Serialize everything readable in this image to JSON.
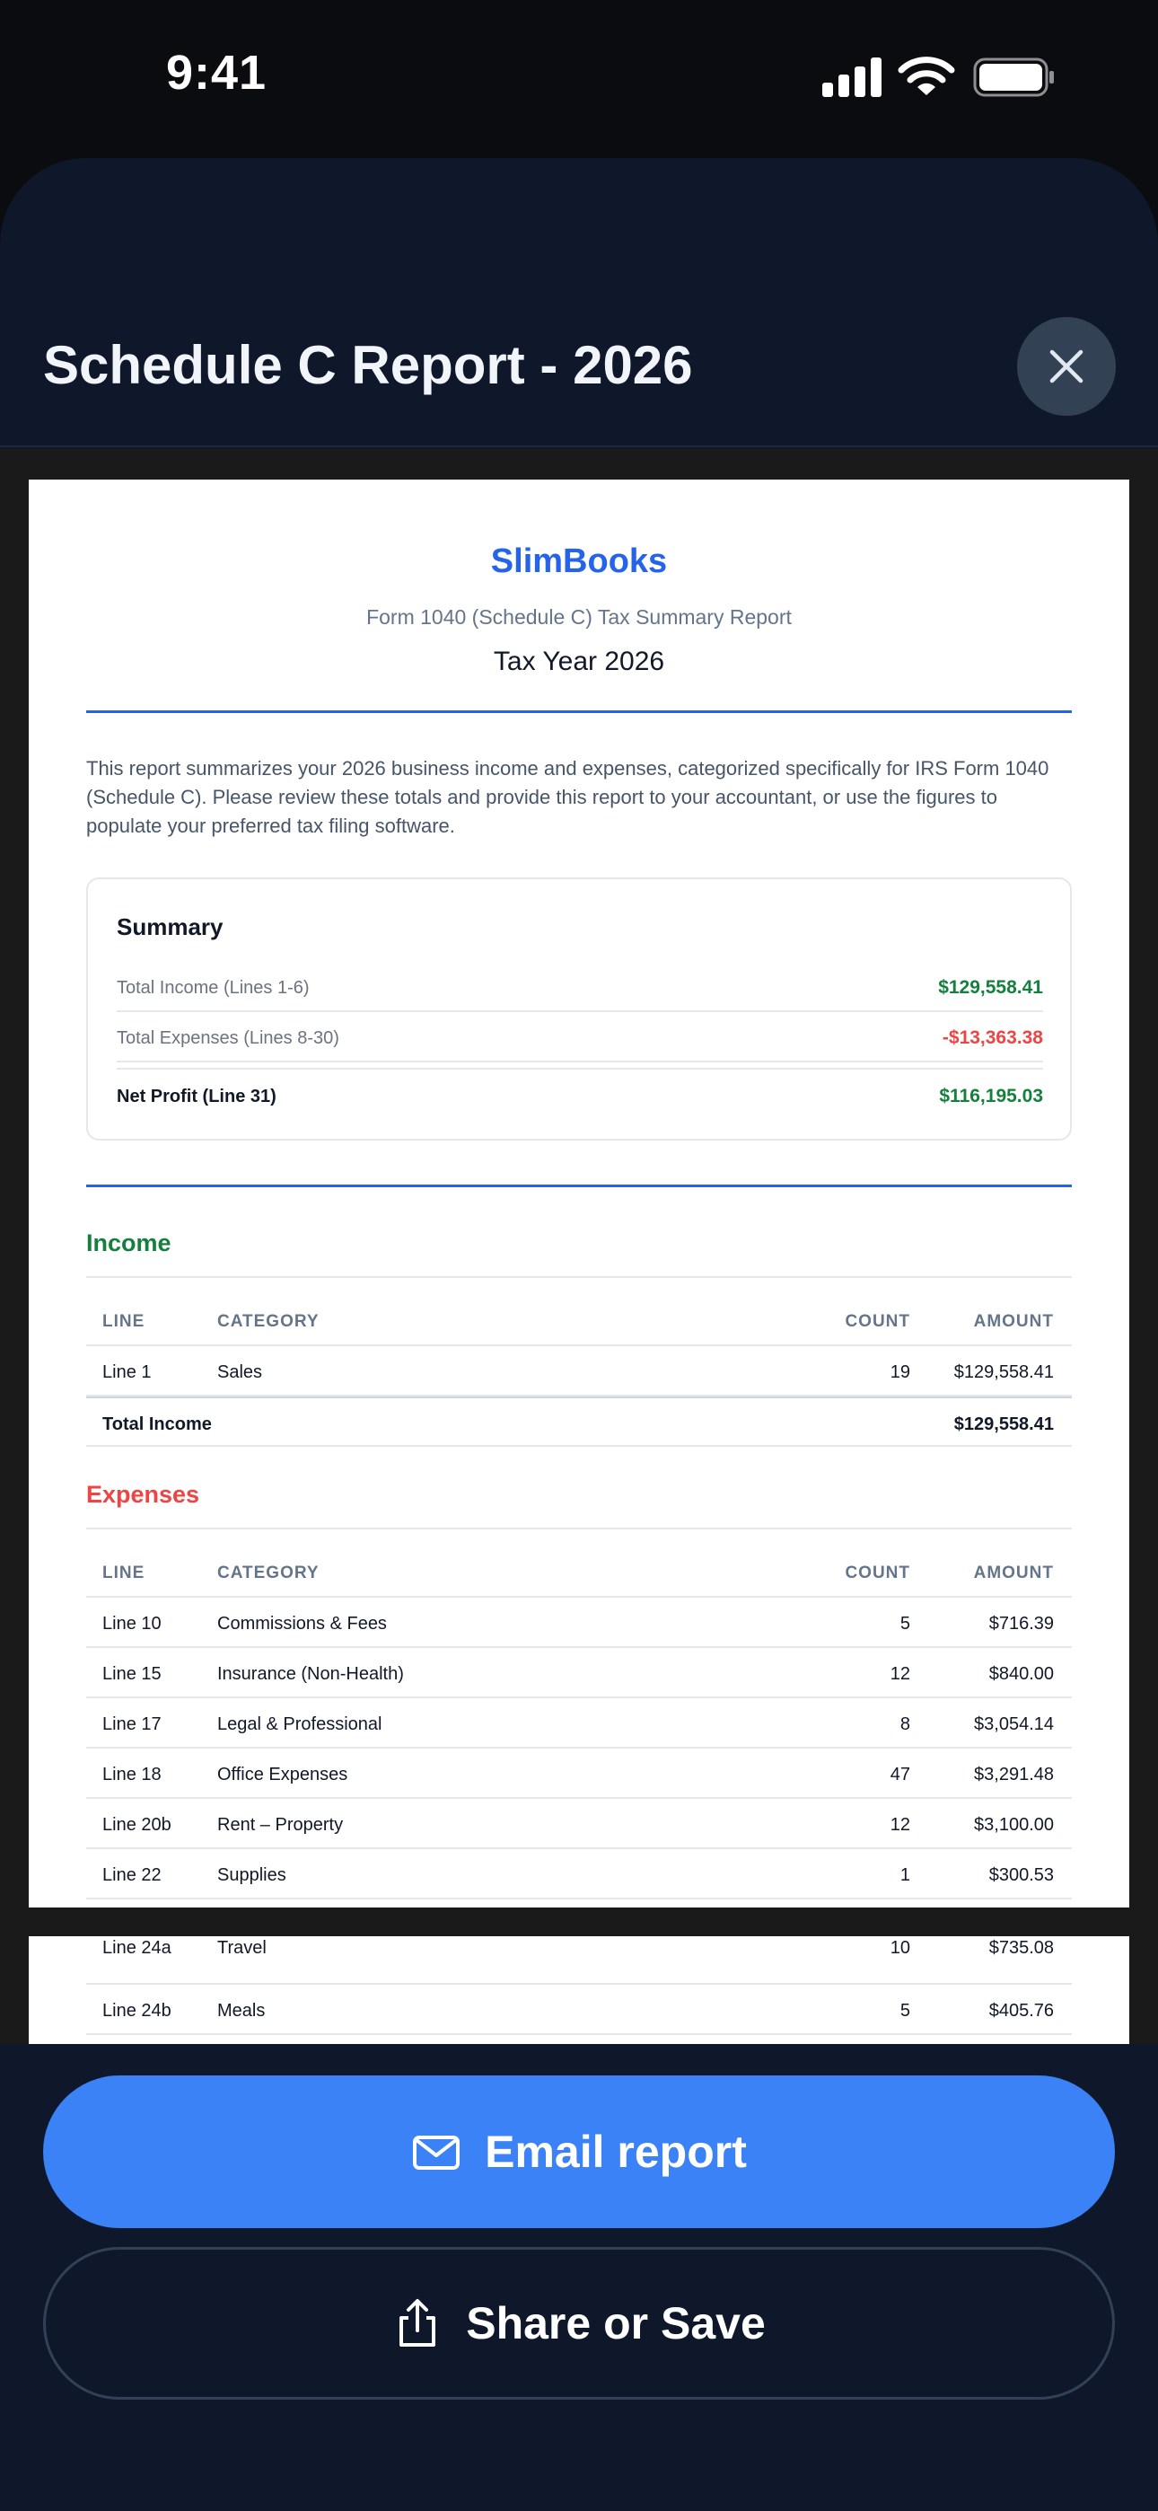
{
  "status_bar": {
    "time": "9:41",
    "icons": [
      "signal-icon",
      "wifi-icon",
      "battery-icon"
    ]
  },
  "sheet": {
    "title": "Schedule C Report - 2026",
    "close_icon": "close-icon"
  },
  "report": {
    "brand": "SlimBooks",
    "subtitle": "Form 1040 (Schedule C) Tax Summary Report",
    "year": "Tax Year 2026",
    "intro": "This report summarizes your 2026 business income and expenses, categorized specifically for IRS Form 1040 (Schedule C). Please review these totals and provide this report to your accountant, or use the figures to populate your preferred tax filing software.",
    "summary": {
      "title": "Summary",
      "income_label": "Total Income (Lines 1-6)",
      "income_value": "$129,558.41",
      "expenses_label": "Total Expenses (Lines 8-30)",
      "expenses_value": "-$13,363.38",
      "net_label": "Net Profit (Line 31)",
      "net_value": "$116,195.03"
    },
    "income": {
      "title": "Income",
      "headers": {
        "line": "LINE",
        "category": "CATEGORY",
        "count": "COUNT",
        "amount": "AMOUNT"
      },
      "rows": [
        {
          "line": "Line 1",
          "category": "Sales",
          "count": "19",
          "amount": "$129,558.41"
        }
      ],
      "total_label": "Total Income",
      "total_value": "$129,558.41"
    },
    "expenses": {
      "title": "Expenses",
      "headers": {
        "line": "LINE",
        "category": "CATEGORY",
        "count": "COUNT",
        "amount": "AMOUNT"
      },
      "rows": [
        {
          "line": "Line 10",
          "category": "Commissions & Fees",
          "count": "5",
          "amount": "$716.39"
        },
        {
          "line": "Line 15",
          "category": "Insurance (Non-Health)",
          "count": "12",
          "amount": "$840.00"
        },
        {
          "line": "Line 17",
          "category": "Legal & Professional",
          "count": "8",
          "amount": "$3,054.14"
        },
        {
          "line": "Line 18",
          "category": "Office Expenses",
          "count": "47",
          "amount": "$3,291.48"
        },
        {
          "line": "Line 20b",
          "category": "Rent – Property",
          "count": "12",
          "amount": "$3,100.00"
        },
        {
          "line": "Line 22",
          "category": "Supplies",
          "count": "1",
          "amount": "$300.53"
        }
      ],
      "page2_rows": [
        {
          "line": "Line 24a",
          "category": "Travel",
          "count": "10",
          "amount": "$735.08"
        },
        {
          "line": "Line 24b",
          "category": "Meals",
          "count": "5",
          "amount": "$405.76"
        }
      ]
    }
  },
  "actions": {
    "email_label": "Email report",
    "email_icon": "mail-icon",
    "share_label": "Share or Save",
    "share_icon": "share-icon"
  },
  "colors": {
    "accent": "#3b82f6",
    "brand": "#2563eb",
    "positive": "#15803d",
    "negative": "#ef4444",
    "sheet_bg": "#0f172a"
  }
}
